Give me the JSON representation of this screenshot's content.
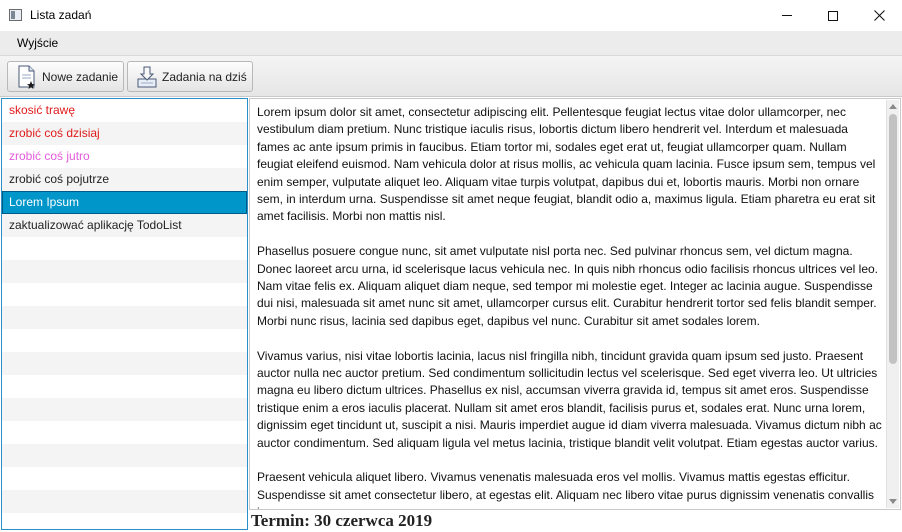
{
  "window": {
    "title": "Lista zadań",
    "icon": "window-app-icon"
  },
  "menu": {
    "items": [
      "Wyjście"
    ]
  },
  "toolbar": {
    "new_task_label": "Nowe zadanie",
    "new_task_icon": "new-document-icon",
    "today_label": "Zadania na dziś",
    "today_icon": "download-filter-icon"
  },
  "task_list": {
    "items": [
      {
        "label": "skosić trawę",
        "color": "#e01b1b"
      },
      {
        "label": "zrobić coś dzisiaj",
        "color": "#e01b1b"
      },
      {
        "label": "zrobić coś jutro",
        "color": "#e35ad9"
      },
      {
        "label": "zrobić coś pojutrze",
        "color": "#222222"
      },
      {
        "label": "Lorem Ipsum",
        "color": "#ffffff",
        "selected": true
      },
      {
        "label": "zaktualizować aplikację TodoList",
        "color": "#222222"
      }
    ],
    "selected_bg": "#0096c9"
  },
  "details": {
    "paragraphs": [
      "Lorem ipsum dolor sit amet, consectetur adipiscing elit. Pellentesque feugiat lectus vitae dolor ullamcorper, nec vestibulum diam pretium. Nunc tristique iaculis risus, lobortis dictum libero hendrerit vel. Interdum et malesuada fames ac ante ipsum primis in faucibus. Etiam tortor mi, sodales eget erat ut, feugiat ullamcorper quam. Nullam feugiat eleifend euismod. Nam vehicula dolor at risus mollis, ac vehicula quam lacinia. Fusce ipsum sem, tempus vel enim semper, vulputate aliquet leo. Aliquam vitae turpis volutpat, dapibus dui et, lobortis mauris. Morbi non ornare sem, in interdum urna. Suspendisse sit amet neque feugiat, blandit odio a, maximus ligula. Etiam pharetra eu erat sit amet facilisis. Morbi non mattis nisl.",
      "Phasellus posuere congue nunc, sit amet vulputate nisl porta nec. Sed pulvinar rhoncus sem, vel dictum magna. Donec laoreet arcu urna, id scelerisque lacus vehicula nec. In quis nibh rhoncus odio facilisis rhoncus ultrices vel leo. Nam vitae felis ex. Aliquam aliquet diam neque, sed tempor mi molestie eget. Integer ac lacinia augue. Suspendisse dui nisi, malesuada sit amet nunc sit amet, ullamcorper cursus elit. Curabitur hendrerit tortor sed felis blandit semper. Morbi nunc risus, lacinia sed dapibus eget, dapibus vel nunc. Curabitur sit amet sodales lorem.",
      "Vivamus varius, nisi vitae lobortis lacinia, lacus nisl fringilla nibh, tincidunt gravida quam ipsum sed justo. Praesent auctor nulla nec auctor pretium. Sed condimentum sollicitudin lectus vel scelerisque. Sed eget viverra leo. Ut ultricies magna eu libero dictum ultrices. Phasellus ex nisl, accumsan viverra gravida id, tempus sit amet eros. Suspendisse tristique enim a eros iaculis placerat. Nullam sit amet eros blandit, facilisis purus et, sodales erat. Nunc urna lorem, dignissim eget tincidunt ut, suscipit a nisi. Mauris imperdiet augue id diam viverra malesuada. Vivamus dictum nibh ac auctor condimentum. Sed aliquam ligula vel metus lacinia, tristique blandit velit volutpat. Etiam egestas auctor varius.",
      "Praesent vehicula aliquet libero. Vivamus venenatis malesuada eros vel mollis. Vivamus mattis egestas efficitur. Suspendisse sit amet consectetur libero, at egestas elit. Aliquam nec libero vitae purus dignissim venenatis convallis in"
    ]
  },
  "deadline": {
    "text": "Termin: 30 czerwca 2019"
  }
}
